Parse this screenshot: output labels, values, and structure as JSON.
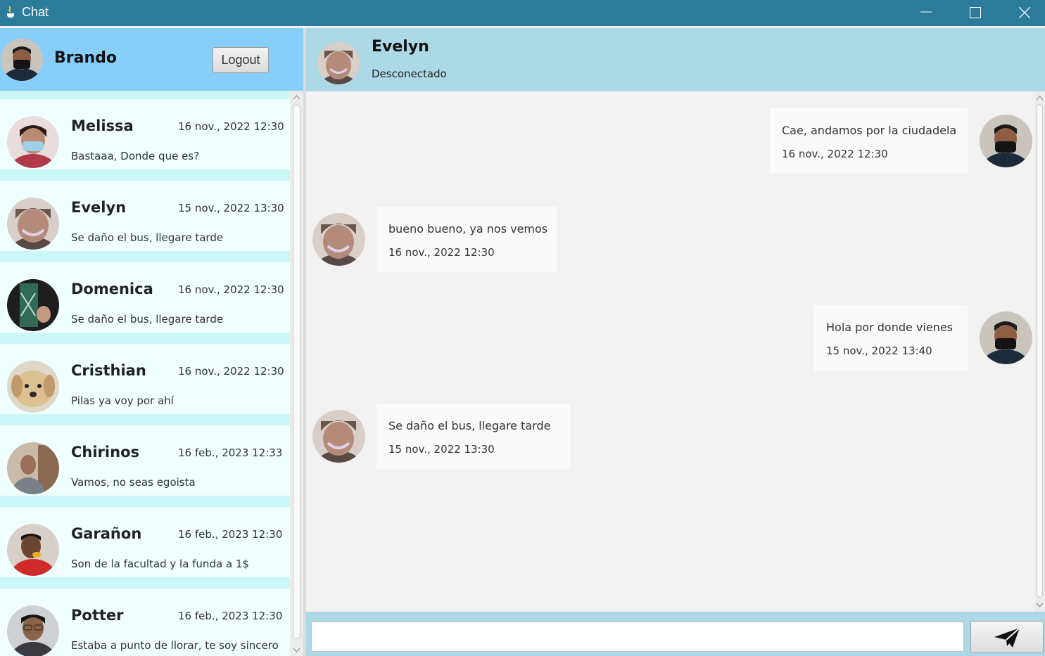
{
  "window": {
    "title": "Chat"
  },
  "current_user": {
    "name": "Brando",
    "logout_label": "Logout"
  },
  "contacts": [
    {
      "name": "Melissa",
      "date": "16 nov., 2022  12:30",
      "last_message": "Bastaaa, Donde que es?",
      "avatar_color": "#c8a0a8"
    },
    {
      "name": "Evelyn",
      "date": "15 nov., 2022  13:30",
      "last_message": "Se daño el bus, llegare tarde",
      "avatar_color": "#b49a8e"
    },
    {
      "name": "Domenica",
      "date": "16 nov., 2022  12:30",
      "last_message": "Se daño el bus, llegare tarde",
      "avatar_color": "#3e5a4a"
    },
    {
      "name": "Cristhian",
      "date": "16 nov., 2022  12:30",
      "last_message": "Pilas ya voy por ahí",
      "avatar_color": "#c8b090"
    },
    {
      "name": "Chirinos",
      "date": "16 feb., 2023  12:33",
      "last_message": "Vamos, no seas egoista",
      "avatar_color": "#8a7868"
    },
    {
      "name": "Garañon",
      "date": "16 feb., 2023  12:30",
      "last_message": "Son de la facultad y la funda a 1$",
      "avatar_color": "#c83030"
    },
    {
      "name": "Potter",
      "date": "16 feb., 2023  12:30",
      "last_message": "Estaba a punto de llorar, te soy sincero",
      "avatar_color": "#6a6a70"
    }
  ],
  "active_chat": {
    "name": "Evelyn",
    "status": "Desconectado"
  },
  "messages": [
    {
      "text": "Cae, andamos por la ciudadela",
      "time": "16 nov., 2022  12:30",
      "from_me": true
    },
    {
      "text": "bueno bueno, ya nos vemos",
      "time": "16 nov., 2022  12:30",
      "from_me": false
    },
    {
      "text": "Hola por donde vienes",
      "time": "15 nov., 2022  13:40",
      "from_me": true
    },
    {
      "text": "Se daño el bus, llegare tarde",
      "time": "15 nov., 2022  13:30",
      "from_me": false
    }
  ],
  "composer": {
    "value": "",
    "placeholder": ""
  },
  "colors": {
    "titlebar": "#2d7b9a",
    "left_header": "#87cefa",
    "chat_header": "#add8e6",
    "contact_bg": "#f0ffff",
    "contact_gap": "#ccf7f7",
    "chat_bg": "#f2f2f2"
  }
}
